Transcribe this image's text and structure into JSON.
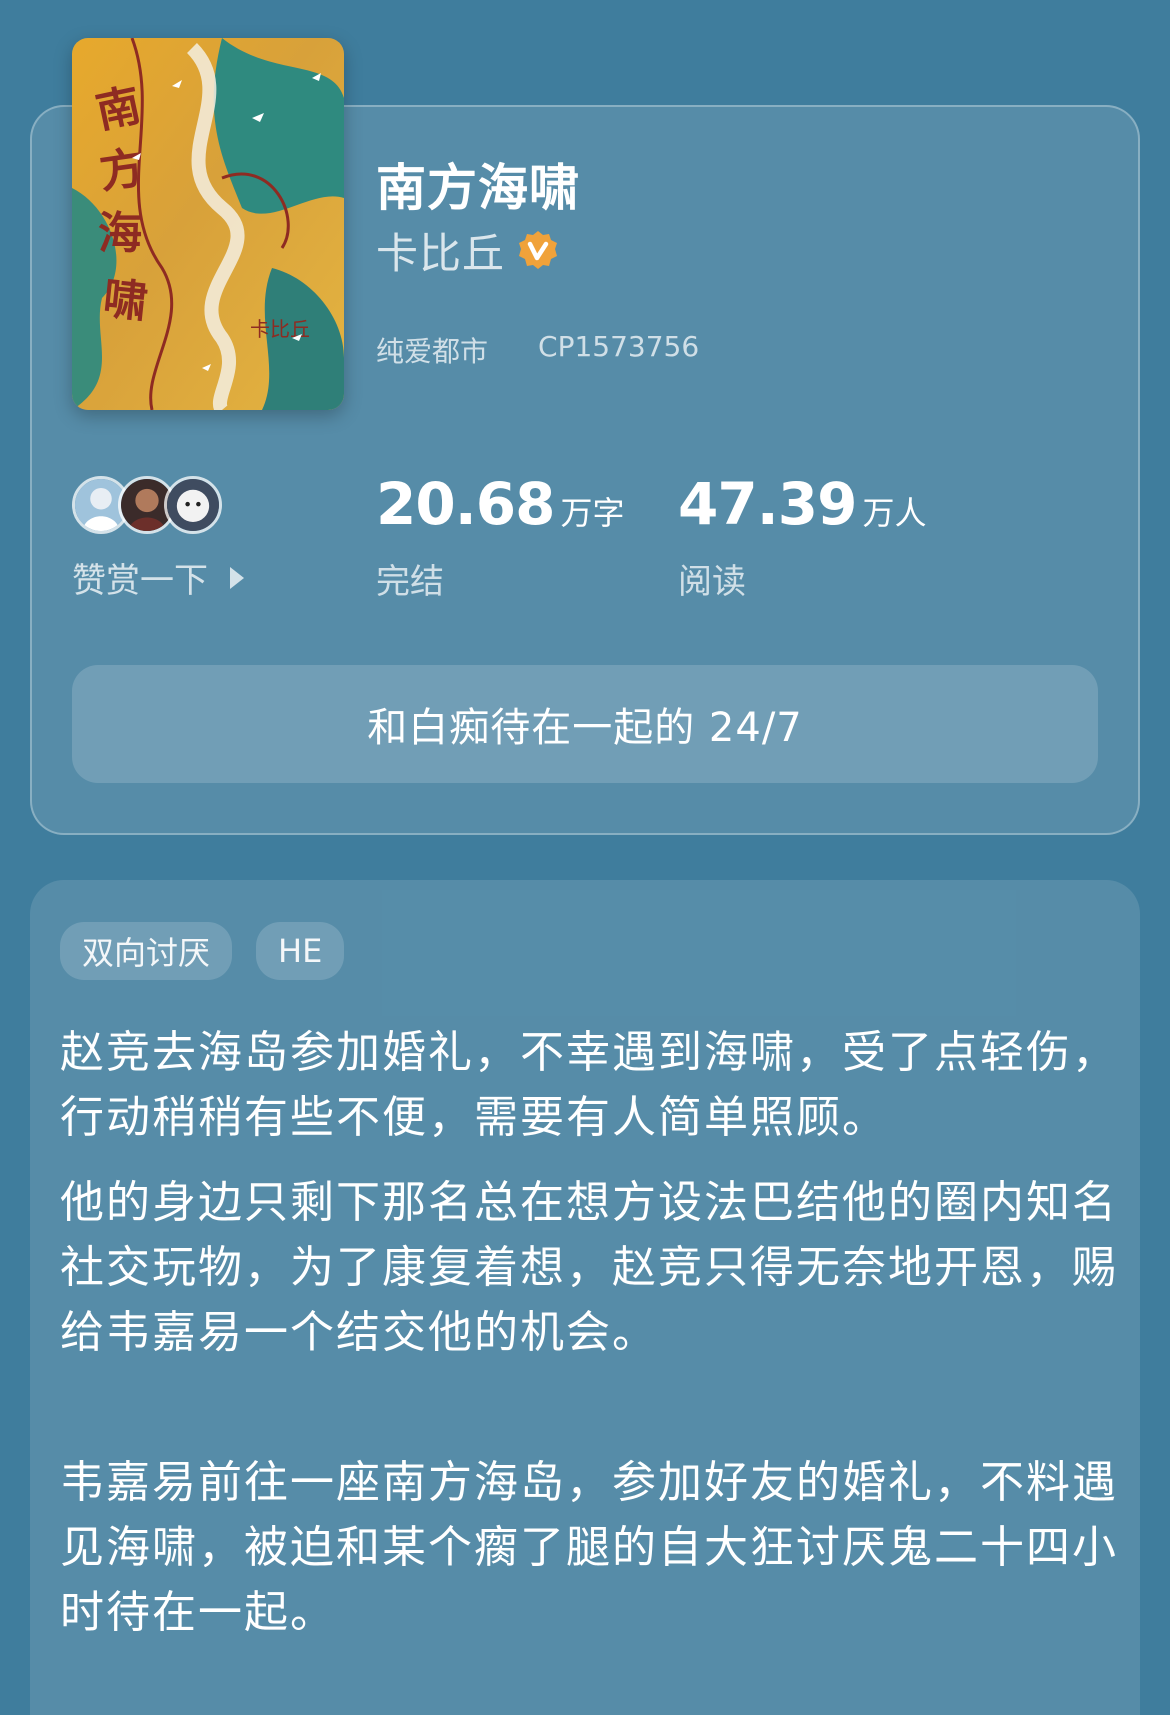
{
  "book": {
    "title": "南方海啸",
    "author": "卡比丘",
    "category": "纯爱都市",
    "cp_code": "CP1573756",
    "word_count": "20.68",
    "word_unit": "万字",
    "status": "完结",
    "readers": "47.39",
    "readers_unit": "万人",
    "readers_label": "阅读",
    "reward_label": "赞赏一下",
    "tagline": "和白痴待在一起的 24/7",
    "cover_icon": "book-cover-art",
    "verified_icon": "verified-v-icon"
  },
  "colors": {
    "background": "#3f7d9d",
    "verified_badge": "#f0a23a",
    "cover_yellow": "#e9b12f",
    "cover_teal": "#2f8a7f"
  },
  "tags": [
    "双向讨厌",
    "HE"
  ],
  "synopsis": [
    "赵竞去海岛参加婚礼，不幸遇到海啸，受了点轻伤，行动稍稍有些不便，需要有人简单照顾。",
    "他的身边只剩下那名总在想方设法巴结他的圈内知名社交玩物，为了康复着想，赵竞只得无奈地开恩，赐给韦嘉易一个结交他的机会。",
    "韦嘉易前往一座南方海岛，参加好友的婚礼，不料遇见海啸，被迫和某个瘸了腿的自大狂讨厌鬼二十四小时待在一起。"
  ]
}
